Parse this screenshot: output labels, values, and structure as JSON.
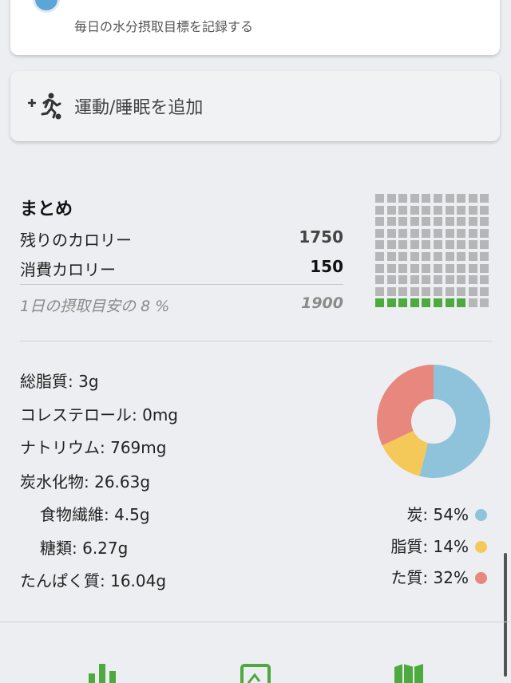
{
  "water": {
    "subtitle": "毎日の水分摂取目標を記録する"
  },
  "exercise": {
    "label": "運動/睡眠を追加",
    "icon": "add-exercise-icon"
  },
  "summary": {
    "title": "まとめ",
    "remaining_label": "残りのカロリー",
    "remaining_value": "1750",
    "burned_label": "消費カロリー",
    "burned_value": "150",
    "daily_label": "1日の摂取目安の 8 %",
    "daily_value": "1900",
    "daily_fraction": 0.08
  },
  "nutrients": {
    "fat": "総脂質: 3g",
    "cholesterol": "コレステロール: 0mg",
    "sodium": "ナトリウム: 769mg",
    "carbs": "炭水化物: 26.63g",
    "fiber": "食物繊維: 4.5g",
    "sugar": "糖類: 6.27g",
    "protein": "たんぱく質: 16.04g"
  },
  "macros": [
    {
      "label": "炭: 54%",
      "percent": 54,
      "color": "#8fc3dc"
    },
    {
      "label": "脂質: 14%",
      "percent": 14,
      "color": "#f5c85a"
    },
    {
      "label": "た質: 32%",
      "percent": 32,
      "color": "#e8877d"
    }
  ],
  "bottom_nav": [
    {
      "icon": "bar-chart-icon",
      "color": "#4caa3e"
    },
    {
      "icon": "image-icon",
      "color": "#4caa3e"
    },
    {
      "icon": "map-icon",
      "color": "#4caa3e"
    }
  ],
  "colors": {
    "accent": "#4caa3e",
    "grid_off": "#b6b6b9"
  }
}
